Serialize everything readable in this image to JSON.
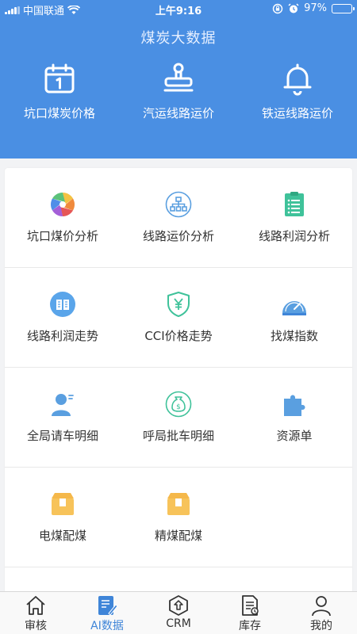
{
  "status_bar": {
    "carrier": "中国联通",
    "time": "上午9:16",
    "battery": "97%",
    "battery_level": 0.97
  },
  "header": {
    "title": "煤炭大数据"
  },
  "quick_actions": [
    {
      "label": "坑口煤炭价格",
      "icon": "calendar-icon"
    },
    {
      "label": "汽运线路运价",
      "icon": "stamp-icon"
    },
    {
      "label": "铁运线路运价",
      "icon": "bell-icon"
    }
  ],
  "grid": [
    {
      "label": "坑口煤价分析",
      "icon": "aperture-icon"
    },
    {
      "label": "线路运价分析",
      "icon": "org-chart-icon"
    },
    {
      "label": "线路利润分析",
      "icon": "list-icon"
    },
    {
      "label": "线路利润走势",
      "icon": "book-icon"
    },
    {
      "label": "CCI价格走势",
      "icon": "yuan-shield-icon"
    },
    {
      "label": "找煤指数",
      "icon": "gauge-icon"
    },
    {
      "label": "全局请车明细",
      "icon": "user-icon"
    },
    {
      "label": "呼局批车明细",
      "icon": "money-bag-icon"
    },
    {
      "label": "资源单",
      "icon": "puzzle-icon"
    },
    {
      "label": "电煤配煤",
      "icon": "box-icon"
    },
    {
      "label": "精煤配煤",
      "icon": "box-icon"
    }
  ],
  "tabbar": [
    {
      "label": "审核",
      "icon": "home-icon",
      "active": false
    },
    {
      "label": "AI数据",
      "icon": "ai-doc-icon",
      "active": true
    },
    {
      "label": "CRM",
      "icon": "crm-icon",
      "active": false
    },
    {
      "label": "库存",
      "icon": "inventory-icon",
      "active": false
    },
    {
      "label": "我的",
      "icon": "profile-icon",
      "active": false
    }
  ],
  "colors": {
    "header_bg": "#4a8fe3",
    "tab_active": "#3f85d8",
    "icon_blue": "#5a9fe0",
    "icon_green": "#3fc29a",
    "icon_yellow": "#f7c35a"
  }
}
